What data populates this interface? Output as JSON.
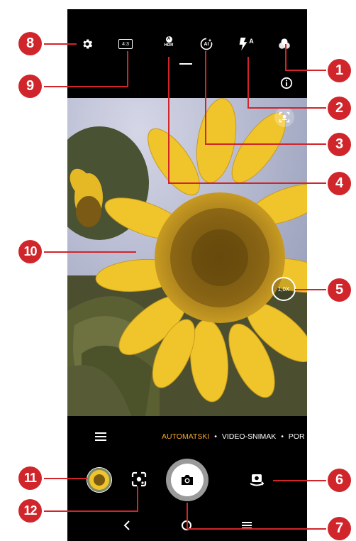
{
  "top_bar": {
    "ratio_label": "4:3",
    "hdr_label": "HDR",
    "hdr_badge": "A",
    "ai_label": "AI",
    "flash_badge": "A"
  },
  "icons": {
    "settings": "gear-icon",
    "aspect_ratio": "aspect-ratio-icon",
    "hdr": "hdr-icon",
    "ai": "ai-scene-icon",
    "flash": "flash-auto-icon",
    "filters": "filters-icon",
    "info": "info-icon",
    "face": "face-detect-icon",
    "menu": "menu-icon",
    "lens": "google-lens-icon",
    "switch": "switch-camera-icon",
    "shutter": "camera-icon",
    "back": "back-icon",
    "home": "home-icon",
    "recents": "recents-icon"
  },
  "zoom": {
    "label": "1,0X"
  },
  "modes": {
    "items": [
      "AUTOMATSKI",
      "VIDEO-SNIMAK",
      "POR"
    ],
    "separator": "•"
  },
  "callouts": [
    "1",
    "2",
    "3",
    "4",
    "5",
    "6",
    "7",
    "8",
    "9",
    "10",
    "11",
    "12"
  ],
  "colors": {
    "callout": "#d0252b",
    "active_mode": "#f2a72d"
  }
}
